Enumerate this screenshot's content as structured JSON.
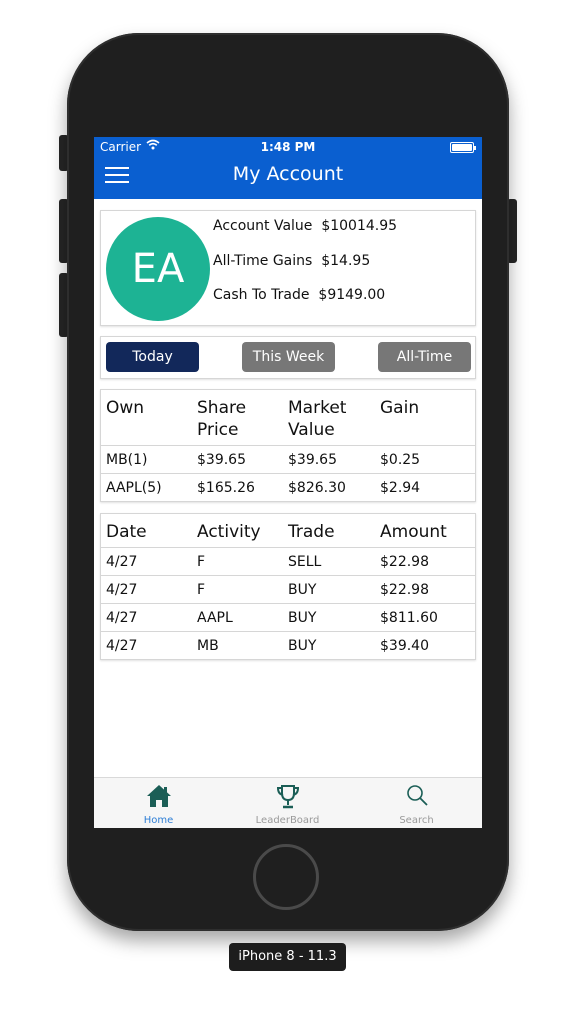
{
  "status_bar": {
    "carrier": "Carrier",
    "time": "1:48 PM"
  },
  "header": {
    "title": "My Account"
  },
  "account": {
    "initials": "EA",
    "rows": [
      {
        "label": "Account Value",
        "value": "$10014.95"
      },
      {
        "label": "All-Time Gains",
        "value": "$14.95"
      },
      {
        "label": "Cash To Trade",
        "value": "$9149.00"
      }
    ]
  },
  "periods": {
    "selected": "Today",
    "options": [
      "Today",
      "This Week",
      "All-Time"
    ]
  },
  "holdings": {
    "headers": [
      "Own",
      "Share Price",
      "Market Value",
      "Gain"
    ],
    "rows": [
      [
        "MB(1)",
        "$39.65",
        "$39.65",
        "$0.25"
      ],
      [
        "AAPL(5)",
        "$165.26",
        "$826.30",
        "$2.94"
      ]
    ]
  },
  "activity": {
    "headers": [
      "Date",
      "Activity",
      "Trade",
      "Amount"
    ],
    "rows": [
      [
        "4/27",
        "F",
        "SELL",
        "$22.98"
      ],
      [
        "4/27",
        "F",
        "BUY",
        "$22.98"
      ],
      [
        "4/27",
        "AAPL",
        "BUY",
        "$811.60"
      ],
      [
        "4/27",
        "MB",
        "BUY",
        "$39.40"
      ]
    ]
  },
  "tabbar": {
    "active": "Home",
    "tabs": [
      {
        "label": "Home",
        "icon": "house-icon"
      },
      {
        "label": "LeaderBoard",
        "icon": "trophy-icon"
      },
      {
        "label": "Search",
        "icon": "magnifier-icon"
      }
    ]
  },
  "device_label": "iPhone 8 - 11.3",
  "colors": {
    "header_blue": "#0a5fd0",
    "avatar_teal": "#1db394",
    "segment_active": "#12285a",
    "segment_inactive": "#777777",
    "tab_icon_green": "#1b5e56",
    "tab_active_label": "#2f7fd6"
  }
}
